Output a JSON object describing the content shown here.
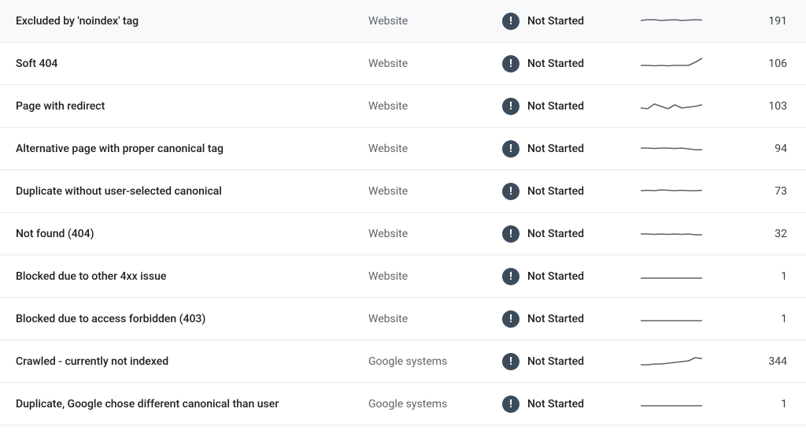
{
  "status_label": "Not Started",
  "rows": [
    {
      "reason": "Excluded by 'noindex' tag",
      "source": "Website",
      "status": "Not Started",
      "count": 191,
      "spark": [
        9,
        8,
        8,
        9,
        8.5,
        8,
        9,
        8.5,
        8,
        8.5
      ]
    },
    {
      "reason": "Soft 404",
      "source": "Website",
      "status": "Not Started",
      "count": 106,
      "spark": [
        12,
        12,
        12.5,
        12,
        12.5,
        12,
        12,
        12,
        8,
        3
      ]
    },
    {
      "reason": "Page with redirect",
      "source": "Website",
      "status": "Not Started",
      "count": 103,
      "spark": [
        12,
        13,
        7,
        10,
        13,
        8,
        12,
        11,
        10,
        8
      ]
    },
    {
      "reason": "Alternative page with proper canonical tag",
      "source": "Website",
      "status": "Not Started",
      "count": 94,
      "spark": [
        9,
        9,
        9.5,
        9,
        9,
        9.5,
        9,
        10,
        11,
        11
      ]
    },
    {
      "reason": "Duplicate without user-selected canonical",
      "source": "Website",
      "status": "Not Started",
      "count": 73,
      "spark": [
        9,
        8.5,
        9,
        8,
        8.5,
        9,
        8.5,
        9,
        9,
        8.5
      ]
    },
    {
      "reason": "Not found (404)",
      "source": "Website",
      "status": "Not Started",
      "count": 32,
      "spark": [
        10,
        10,
        10.5,
        10,
        10.5,
        10,
        10.5,
        10,
        11,
        11
      ]
    },
    {
      "reason": "Blocked due to other 4xx issue",
      "source": "Website",
      "status": "Not Started",
      "count": 1,
      "spark": [
        12,
        12,
        12,
        12,
        12,
        12,
        12,
        12,
        12,
        12
      ]
    },
    {
      "reason": "Blocked due to access forbidden (403)",
      "source": "Website",
      "status": "Not Started",
      "count": 1,
      "spark": [
        12,
        12,
        12,
        12,
        12,
        12,
        12,
        12,
        12,
        12
      ]
    },
    {
      "reason": "Crawled - currently not indexed",
      "source": "Google systems",
      "status": "Not Started",
      "count": 344,
      "spark": [
        14,
        14,
        13,
        13,
        12,
        11,
        10,
        9,
        5,
        6
      ]
    },
    {
      "reason": "Duplicate, Google chose different canonical than user",
      "source": "Google systems",
      "status": "Not Started",
      "count": 1,
      "spark": [
        12,
        12,
        12,
        12,
        12,
        12,
        12,
        12,
        12,
        12
      ]
    }
  ]
}
